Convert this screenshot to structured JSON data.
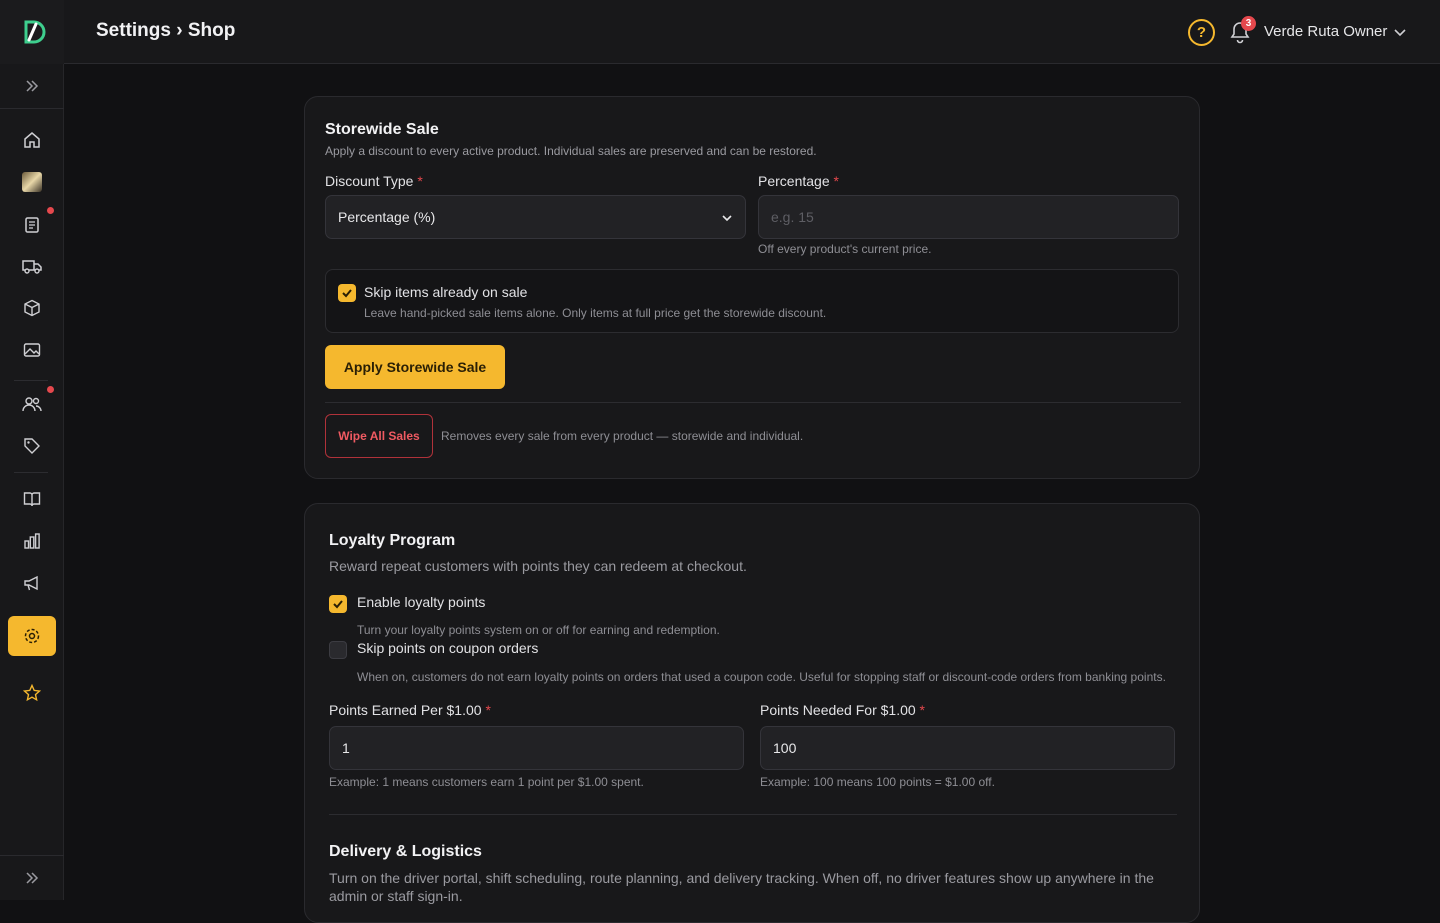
{
  "header": {
    "breadcrumb": "Settings › Shop",
    "help_glyph": "?",
    "notification_count": "3",
    "user_name": "Verde Ruta Owner"
  },
  "sidebar": {
    "items": [
      {
        "icon": "home-icon"
      },
      {
        "icon": "store-image-icon"
      },
      {
        "icon": "clipboard-icon",
        "badge": true
      },
      {
        "icon": "truck-icon"
      },
      {
        "icon": "box-icon"
      },
      {
        "icon": "image-icon"
      },
      {
        "icon": "users-icon",
        "badge": true
      },
      {
        "icon": "tag-icon"
      },
      {
        "icon": "book-icon"
      },
      {
        "icon": "chart-icon"
      },
      {
        "icon": "megaphone-icon"
      },
      {
        "icon": "gear-icon",
        "active": true
      },
      {
        "icon": "star-icon"
      }
    ]
  },
  "storewide": {
    "title": "Storewide Sale",
    "subtitle": "Apply a discount to every active product. Individual sales are preserved and can be restored.",
    "discount_type_label": "Discount Type",
    "discount_type_value": "Percentage (%)",
    "percentage_label": "Percentage",
    "percentage_placeholder": "e.g. 15",
    "percentage_hint": "Off every product's current price.",
    "skip_label": "Skip items already on sale",
    "skip_desc": "Leave hand-picked sale items alone. Only items at full price get the storewide discount.",
    "skip_checked": true,
    "apply_label": "Apply Storewide Sale",
    "wipe_label": "Wipe All Sales",
    "wipe_desc": "Removes every sale from every product — storewide and individual."
  },
  "loyalty": {
    "title": "Loyalty Program",
    "subtitle": "Reward repeat customers with points they can redeem at checkout.",
    "enable_label": "Enable loyalty points",
    "enable_desc": "Turn your loyalty points system on or off for earning and redemption.",
    "enable_checked": true,
    "skip_coupon_label": "Skip points on coupon orders",
    "skip_coupon_desc": "When on, customers do not earn loyalty points on orders that used a coupon code. Useful for stopping staff or discount-code orders from banking points.",
    "skip_coupon_checked": false,
    "earned_label": "Points Earned Per $1.00",
    "earned_value": "1",
    "earned_hint": "Example: 1 means customers earn 1 point per $1.00 spent.",
    "needed_label": "Points Needed For $1.00",
    "needed_value": "100",
    "needed_hint": "Example: 100 means 100 points = $1.00 off."
  },
  "delivery": {
    "title": "Delivery & Logistics",
    "subtitle": "Turn on the driver portal, shift scheduling, route planning, and delivery tracking. When off, no driver features show up anywhere in the admin or staff sign-in."
  },
  "required_mark": "*",
  "colors": {
    "accent": "#f5b82e",
    "danger": "#e5484d",
    "background": "#111113",
    "card": "#18181a"
  }
}
